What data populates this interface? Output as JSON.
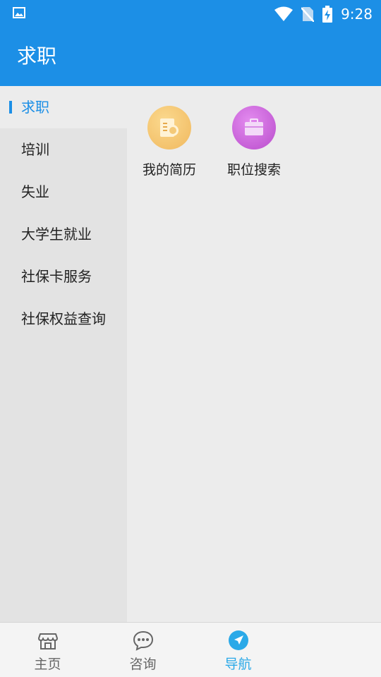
{
  "status_bar": {
    "time": "9:28",
    "icons": [
      "image-icon",
      "wifi-icon",
      "no-sim-icon",
      "battery-charging-icon"
    ]
  },
  "app_bar": {
    "title": "求职"
  },
  "sidebar": {
    "items": [
      {
        "label": "求职",
        "active": true
      },
      {
        "label": "培训",
        "active": false
      },
      {
        "label": "失业",
        "active": false
      },
      {
        "label": "大学生就业",
        "active": false
      },
      {
        "label": "社保卡服务",
        "active": false
      },
      {
        "label": "社保权益查询",
        "active": false
      }
    ]
  },
  "content": {
    "tiles": [
      {
        "label": "我的简历",
        "icon": "resume-icon",
        "color": "#f2c070"
      },
      {
        "label": "职位搜索",
        "icon": "briefcase-icon",
        "color": "#c85ad6"
      }
    ]
  },
  "tab_bar": {
    "tabs": [
      {
        "label": "主页",
        "icon": "store-icon",
        "active": false
      },
      {
        "label": "咨询",
        "icon": "chat-icon",
        "active": false
      },
      {
        "label": "导航",
        "icon": "navigation-icon",
        "active": true
      }
    ]
  },
  "colors": {
    "primary": "#1c8fe6",
    "active_tab": "#2aa9e8"
  }
}
